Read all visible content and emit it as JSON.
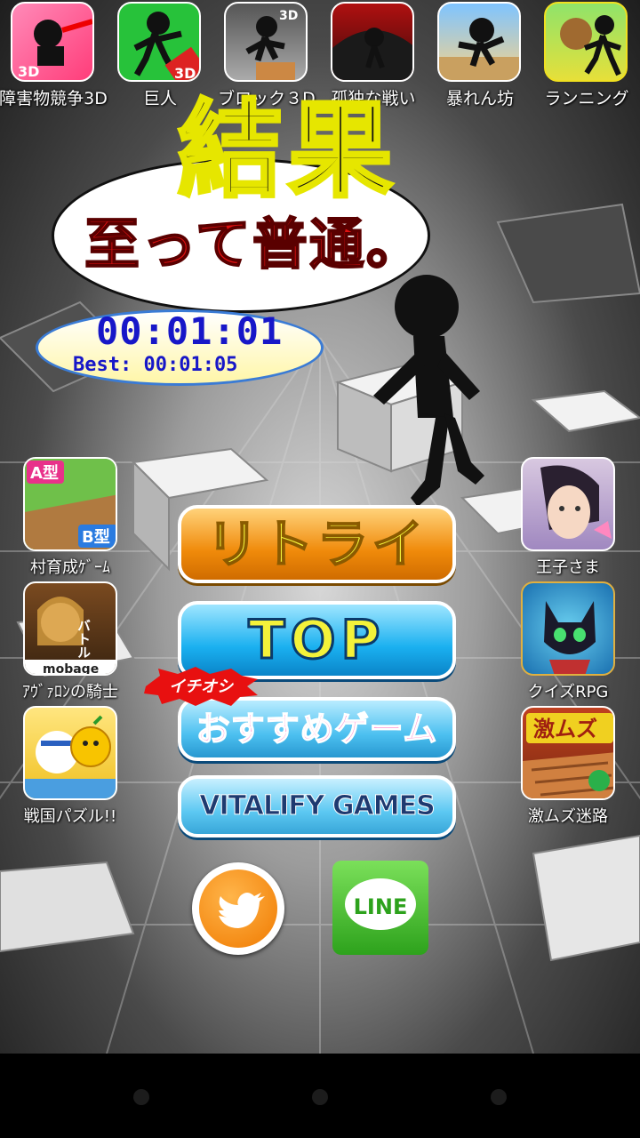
{
  "top_apps": [
    {
      "label": "障害物競争3D",
      "icon": "obstacle-race-3d-icon"
    },
    {
      "label": "巨人",
      "icon": "giant-icon"
    },
    {
      "label": "ブロック３D",
      "icon": "block-3d-icon"
    },
    {
      "label": "孤独な戦い",
      "icon": "lonely-battle-icon"
    },
    {
      "label": "暴れん坊",
      "icon": "rampage-icon"
    },
    {
      "label": "ランニング",
      "icon": "running-icon"
    }
  ],
  "left_apps": [
    {
      "label": "村育成ｹﾞｰﾑ",
      "icon": "village-game-icon",
      "badge_a": "A型",
      "badge_b": "B型"
    },
    {
      "label": "ｱｳﾞｧﾛﾝの騎士",
      "icon": "avalon-knight-icon",
      "text": "バトルを通し強くなる",
      "brand": "mobage"
    },
    {
      "label": "戦国パズル!!",
      "icon": "sengoku-puzzle-icon"
    }
  ],
  "right_apps": [
    {
      "label": "王子さま",
      "icon": "prince-icon"
    },
    {
      "label": "クイズRPG",
      "icon": "quiz-rpg-icon"
    },
    {
      "label": "激ムズ迷路",
      "icon": "hard-maze-icon",
      "text": "激ムズ"
    }
  ],
  "result": {
    "title": "結果",
    "rating": "至って普通。",
    "time": "00:01:01",
    "best": "Best: 00:01:05"
  },
  "buttons": {
    "retry": "リトライ",
    "top": "TOP",
    "recommend": "おすすめゲーム",
    "recommend_badge": "イチオシ",
    "vitalify": "VITALIFY GAMES"
  },
  "social": {
    "twitter": "twitter-bird-icon",
    "line": "LINE"
  },
  "colors": {
    "retry": "#f08a0a",
    "top": "#1ab0f0",
    "title_red": "#e01010",
    "time_blue": "#1717c8"
  }
}
